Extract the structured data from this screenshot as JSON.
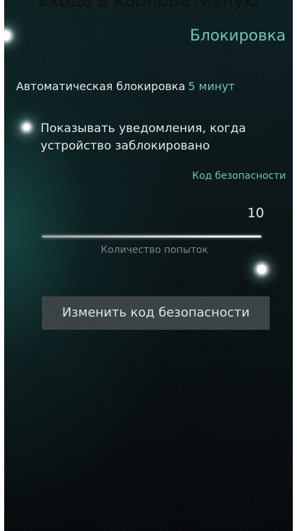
{
  "top_banner": {
    "text": "входа в корпоративную"
  },
  "header": {
    "title": "Блокировка"
  },
  "auto_lock": {
    "label": "Автоматическая блокировка",
    "value": "5 минут"
  },
  "notifications": {
    "label": "Показывать уведомления, когда устройство заблокировано",
    "enabled": true
  },
  "security_section": {
    "header": "Код безопасности"
  },
  "attempts_slider": {
    "value_text": "10",
    "value": 10,
    "fill_fraction": 1.0,
    "label": "Количество попыток"
  },
  "change_code_button": {
    "label": "Изменить код безопасности"
  },
  "colors": {
    "accent": "#6fc4ad",
    "text_primary": "#e4e8e8",
    "text_secondary": "#7c8688",
    "button_bg": "#3b4244"
  }
}
